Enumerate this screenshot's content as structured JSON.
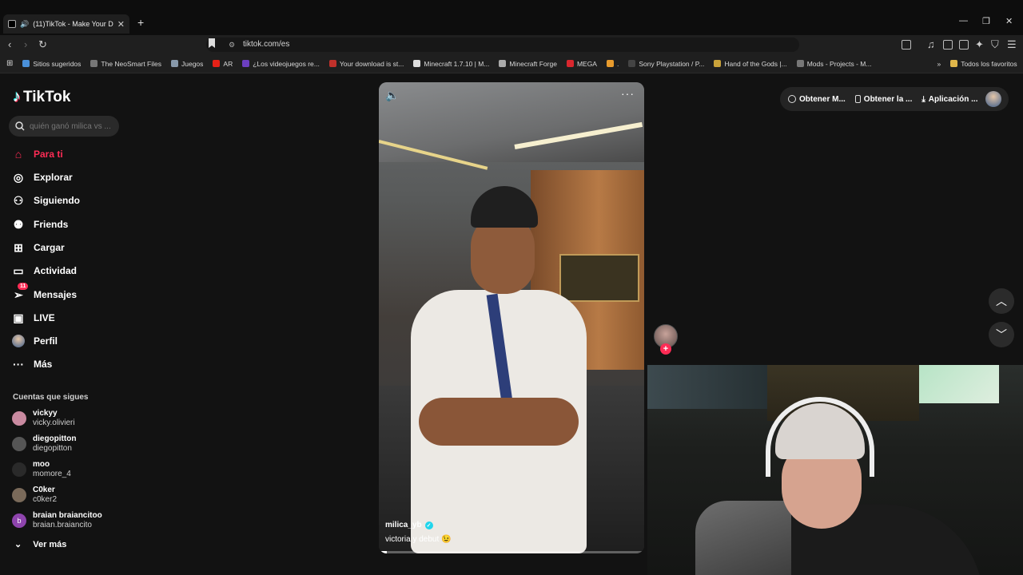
{
  "browser": {
    "tab_title": "(11)TikTok - Make Your Day",
    "new_tab": "+",
    "url": "tiktok.com/es",
    "bookmarks": [
      {
        "label": "Sitios sugeridos",
        "color": "#4a90d9"
      },
      {
        "label": "The NeoSmart Files",
        "color": "#777777"
      },
      {
        "label": "Juegos",
        "color": "#8899aa"
      },
      {
        "label": "AR",
        "color": "#e62117"
      },
      {
        "label": "¿Los videojuegos re...",
        "color": "#6c3fbf"
      },
      {
        "label": "Your download is st...",
        "color": "#c0312b"
      },
      {
        "label": "Minecraft 1.7.10 | M...",
        "color": "#dddddd"
      },
      {
        "label": "Minecraft Forge",
        "color": "#aaaaaa"
      },
      {
        "label": "MEGA",
        "color": "#d9272e"
      },
      {
        "label": ".",
        "color": "#e89b2d"
      },
      {
        "label": "Sony Playstation / P...",
        "color": "#444444"
      },
      {
        "label": "Hand of the Gods |...",
        "color": "#c9a23a"
      },
      {
        "label": "Mods - Projects - M...",
        "color": "#777777"
      }
    ],
    "all_favorites": "Todos los favoritos"
  },
  "sidebar": {
    "logo": "TikTok",
    "search_placeholder": "quién ganó milica vs ...",
    "nav": [
      {
        "label": "Para ti",
        "icon": "home-icon"
      },
      {
        "label": "Explorar",
        "icon": "compass-icon"
      },
      {
        "label": "Siguiendo",
        "icon": "following-icon"
      },
      {
        "label": "Friends",
        "icon": "friends-icon"
      },
      {
        "label": "Cargar",
        "icon": "upload-icon"
      },
      {
        "label": "Actividad",
        "icon": "activity-icon"
      },
      {
        "label": "Mensajes",
        "icon": "messages-icon",
        "badge": "11"
      },
      {
        "label": "LIVE",
        "icon": "live-icon"
      },
      {
        "label": "Perfil",
        "icon": "profile-avatar"
      },
      {
        "label": "Más",
        "icon": "more-icon"
      }
    ],
    "following_title": "Cuentas que sigues",
    "accounts": [
      {
        "name": "vickyy",
        "handle": "vicky.olivieri",
        "color": "#c98aa0"
      },
      {
        "name": "diegopitton",
        "handle": "diegopitton",
        "color": "#555555"
      },
      {
        "name": "moo",
        "handle": "momore_4",
        "color": "#2a2a2a"
      },
      {
        "name": "C0ker",
        "handle": "c0ker2",
        "color": "#7a6a5a"
      },
      {
        "name": "braian braiancitoo",
        "handle": "braian.braiancito",
        "color": "#8e44ad",
        "initial": "b"
      }
    ],
    "see_more": "Ver más"
  },
  "video": {
    "username": "milica_yb",
    "caption": "victoria y debut 😉",
    "progress": 0.03
  },
  "top_actions": [
    {
      "label": "Obtener M..."
    },
    {
      "label": "Obtener la ..."
    },
    {
      "label": "Aplicación ..."
    }
  ],
  "colors": {
    "accent": "#fe2c55",
    "background": "#121212"
  }
}
